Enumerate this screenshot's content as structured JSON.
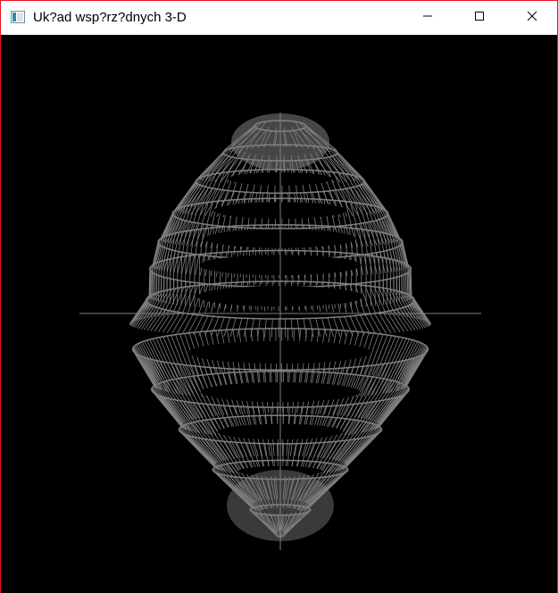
{
  "window": {
    "title": "Uk?ad wsp?rz?dnych 3-D",
    "icons": [
      "app-icon",
      "minimize-icon",
      "maximize-icon",
      "close-icon"
    ]
  },
  "scene": {
    "background": "#000000",
    "line_color": "#808080",
    "render_style": "wireframe egg-shaped surface with horizontal bands and radial lines, centered axis cross"
  }
}
